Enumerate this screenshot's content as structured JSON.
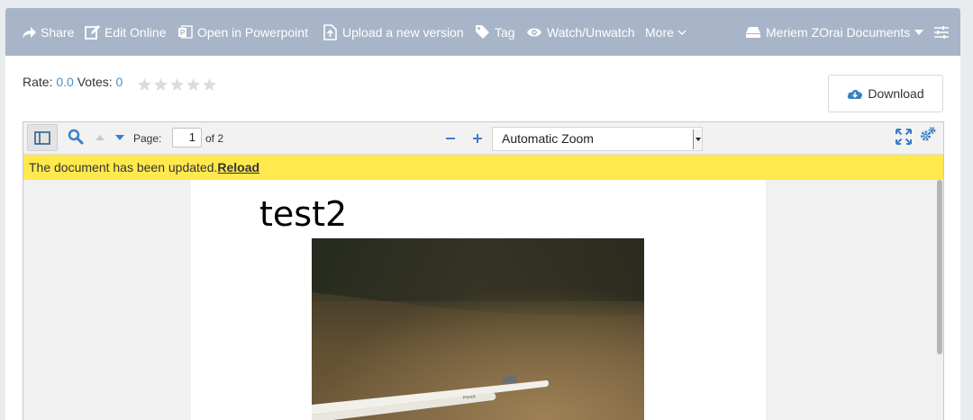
{
  "header": {
    "share_label": "Share",
    "edit_label": "Edit Online",
    "powerpoint_label": "Open in Powerpoint",
    "upload_label": "Upload a new version",
    "tag_label": "Tag",
    "watch_label": "Watch/Unwatch",
    "more_label": "More",
    "drive_label": "Meriem ZOrai Documents"
  },
  "rating": {
    "rate_label": "Rate:",
    "rate_value": "0.0",
    "votes_label": "Votes:",
    "votes_value": "0",
    "stars_filled": 0,
    "stars_total": 5
  },
  "download_label": "Download",
  "viewer": {
    "page_label": "Page:",
    "page_value": "1",
    "page_total": "of 2",
    "zoom_value": "Automatic Zoom",
    "notice_text": "The document has been updated.",
    "reload_label": "Reload"
  },
  "document": {
    "title": "test2"
  },
  "colors": {
    "header_bg": "#a8b5c8",
    "notice_bg": "#ffe94d",
    "link_blue": "#4a90c8",
    "icon_blue": "#3a7fc4"
  }
}
